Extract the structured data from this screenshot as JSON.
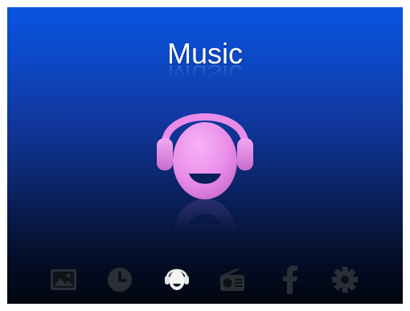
{
  "screen": {
    "title": "Music",
    "hero_icon": "headphones-face-icon",
    "accent_color": "#e98ce9"
  },
  "dock": {
    "items": [
      {
        "icon": "picture-icon",
        "selected": false
      },
      {
        "icon": "clock-icon",
        "selected": false
      },
      {
        "icon": "headphones-icon",
        "selected": true
      },
      {
        "icon": "radio-icon",
        "selected": false
      },
      {
        "icon": "facebook-icon",
        "selected": false
      },
      {
        "icon": "gear-icon",
        "selected": false
      }
    ],
    "dim_color": "#2a2f36",
    "selected_color": "#e6e6e6"
  }
}
